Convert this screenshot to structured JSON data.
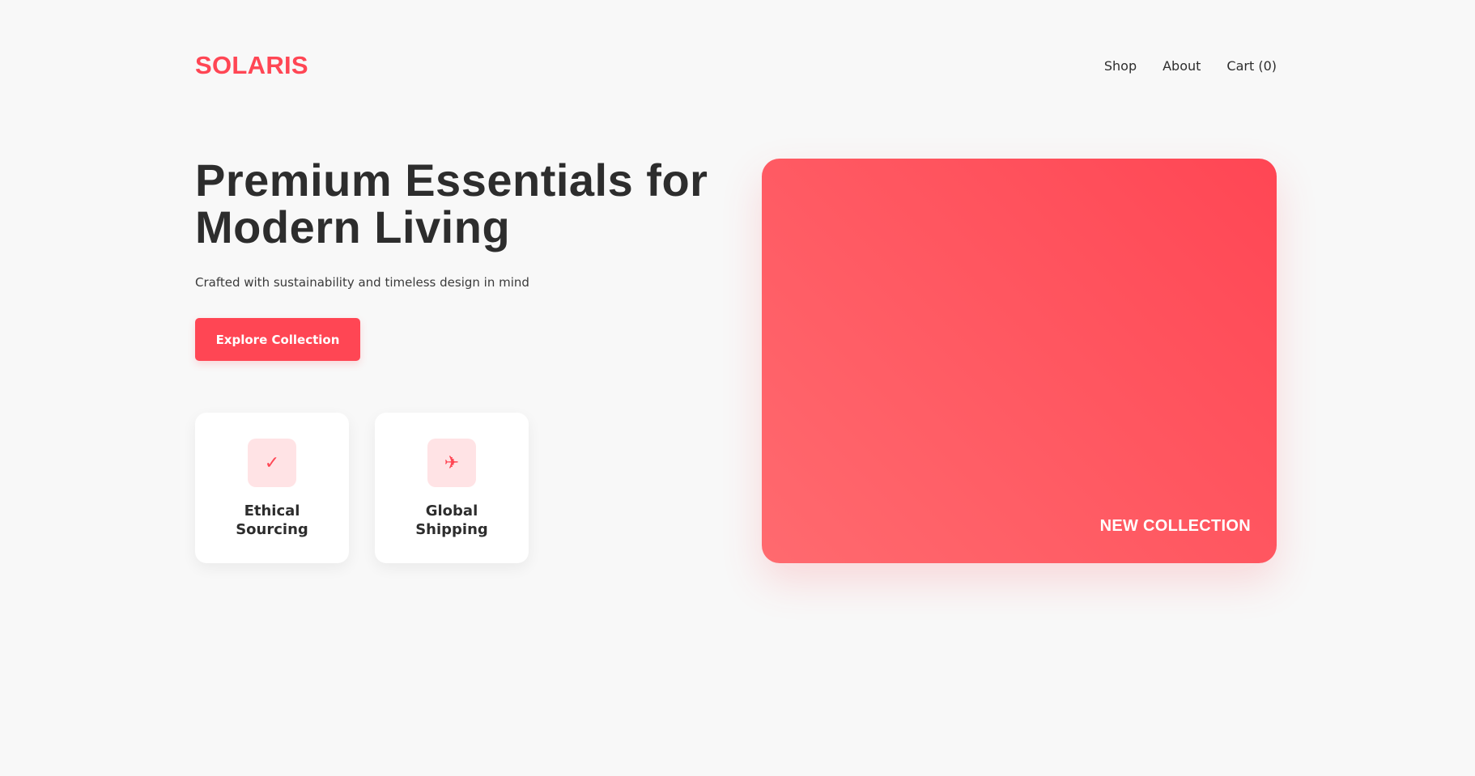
{
  "brand": {
    "logo_text": "SOLARIS",
    "accent_color": "#ff4654"
  },
  "nav": {
    "items": [
      {
        "label": "Shop"
      },
      {
        "label": "About"
      },
      {
        "label": "Cart (0)"
      }
    ]
  },
  "hero": {
    "title_line1": "Premium Essentials for",
    "title_line2": "Modern Living",
    "subtitle": "Crafted with sustainability and timeless design in mind",
    "cta_label": "Explore Collection",
    "visual_label": "NEW COLLECTION"
  },
  "features": [
    {
      "icon": "check-icon",
      "glyph": "✓",
      "label": "Ethical Sourcing"
    },
    {
      "icon": "airplane-icon",
      "glyph": "✈",
      "label": "Global Shipping"
    }
  ]
}
